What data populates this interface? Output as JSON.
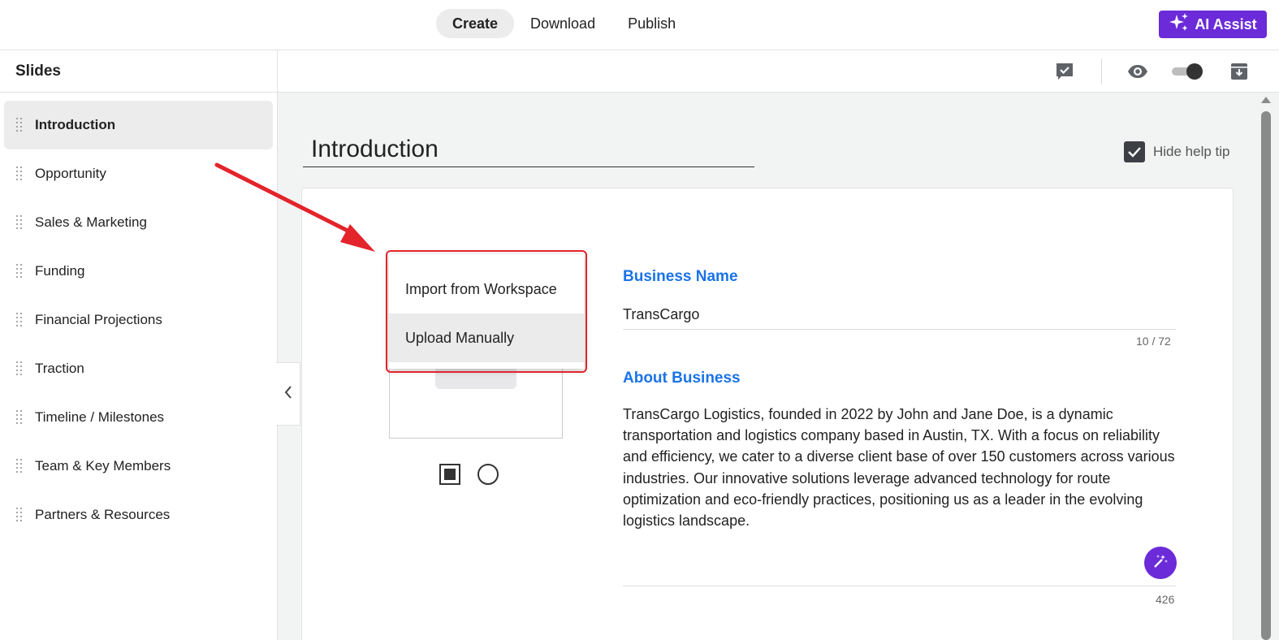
{
  "header": {
    "tabs": [
      {
        "label": "Create",
        "active": true
      },
      {
        "label": "Download",
        "active": false
      },
      {
        "label": "Publish",
        "active": false
      }
    ],
    "ai_assist_label": "AI Assist",
    "accent_color": "#6b2bd8"
  },
  "sidebar": {
    "title": "Slides",
    "items": [
      {
        "label": "Introduction",
        "active": true
      },
      {
        "label": "Opportunity"
      },
      {
        "label": "Sales & Marketing"
      },
      {
        "label": "Funding"
      },
      {
        "label": "Financial Projections"
      },
      {
        "label": "Traction"
      },
      {
        "label": "Timeline / Milestones"
      },
      {
        "label": "Team & Key Members"
      },
      {
        "label": "Partners & Resources"
      }
    ]
  },
  "toolbar": {
    "icons": [
      "comment-check-icon",
      "eye-icon",
      "toggle-switch",
      "archive-icon"
    ]
  },
  "slide": {
    "heading": "Introduction",
    "hide_help_tip_label": "Hide help tip",
    "hide_help_tip_checked": true
  },
  "image_menu": {
    "items": [
      "Import from Workspace",
      "Upload Manually"
    ]
  },
  "business_name": {
    "label": "Business Name",
    "value": "TransCargo",
    "counter": "10 / 72"
  },
  "about_business": {
    "label": "About Business",
    "value": "TransCargo Logistics, founded in 2022 by John and Jane Doe, is a dynamic transportation and logistics company based in Austin, TX. With a focus on reliability and efficiency, we cater to a diverse client base of over 150 customers across various industries. Our innovative solutions leverage advanced technology for route optimization and eco-friendly practices, positioning us as a leader in the evolving logistics landscape.",
    "counter": "426"
  },
  "annotation": {
    "highlight_color": "#e3242b"
  }
}
